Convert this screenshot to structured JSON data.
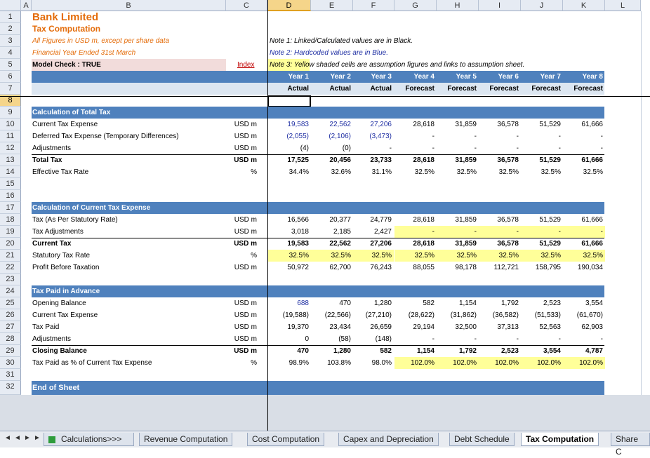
{
  "columns": [
    "A",
    "B",
    "C",
    "D",
    "E",
    "F",
    "G",
    "H",
    "I",
    "J",
    "K",
    "L"
  ],
  "rows": [
    "1",
    "2",
    "3",
    "4",
    "5",
    "6",
    "7",
    "8",
    "9",
    "10",
    "11",
    "12",
    "13",
    "14",
    "15",
    "16",
    "17",
    "18",
    "19",
    "20",
    "21",
    "22",
    "23",
    "24",
    "25",
    "26",
    "27",
    "28",
    "29",
    "30",
    "31",
    "32"
  ],
  "header": {
    "title": "Bank Limited",
    "subtitle": "Tax Computation",
    "figures_note": "All Figures in USD m, except per share data",
    "fy_note": "Financial Year Ended 31st March",
    "model_check": "Model Check : TRUE",
    "index_link": "Index",
    "note1": "Note 1: Linked/Calculated values are in Black.",
    "note2": "Note 2: Hardcoded values are in Blue.",
    "note3": "Note 3: Yellow shaded cells are assumption figures and links to assumption sheet."
  },
  "years": [
    "Year 1",
    "Year 2",
    "Year 3",
    "Year 4",
    "Year 5",
    "Year 6",
    "Year 7",
    "Year 8"
  ],
  "periods": [
    "Actual",
    "Actual",
    "Actual",
    "Forecast",
    "Forecast",
    "Forecast",
    "Forecast",
    "Forecast"
  ],
  "sections": {
    "total_tax": "Calculation of Total Tax",
    "current_tax": "Calculation of Current Tax Expense",
    "advance": "Tax Paid in Advance",
    "end": "End of Sheet"
  },
  "rows_data": {
    "r10": {
      "label": "Current Tax Expense",
      "unit": "USD m",
      "vals": [
        "19,583",
        "22,562",
        "27,206",
        "28,618",
        "31,859",
        "36,578",
        "51,529",
        "61,666"
      ]
    },
    "r11": {
      "label": "Deferred Tax Expense (Temporary Differences)",
      "unit": "USD m",
      "vals": [
        "(2,055)",
        "(2,106)",
        "(3,473)",
        "-",
        "-",
        "-",
        "-",
        "-"
      ]
    },
    "r12": {
      "label": "Adjustments",
      "unit": "USD m",
      "vals": [
        "(4)",
        "(0)",
        "-",
        "-",
        "-",
        "-",
        "-",
        "-"
      ]
    },
    "r13": {
      "label": "Total Tax",
      "unit": "USD m",
      "vals": [
        "17,525",
        "20,456",
        "23,733",
        "28,618",
        "31,859",
        "36,578",
        "51,529",
        "61,666"
      ]
    },
    "r14": {
      "label": "Effective Tax Rate",
      "unit": "%",
      "vals": [
        "34.4%",
        "32.6%",
        "31.1%",
        "32.5%",
        "32.5%",
        "32.5%",
        "32.5%",
        "32.5%"
      ]
    },
    "r18": {
      "label": "Tax (As Per Statutory Rate)",
      "unit": "USD m",
      "vals": [
        "16,566",
        "20,377",
        "24,779",
        "28,618",
        "31,859",
        "36,578",
        "51,529",
        "61,666"
      ]
    },
    "r19": {
      "label": "Tax Adjustments",
      "unit": "USD m",
      "vals": [
        "3,018",
        "2,185",
        "2,427",
        "-",
        "-",
        "-",
        "-",
        "-"
      ]
    },
    "r20": {
      "label": "Current Tax",
      "unit": "USD m",
      "vals": [
        "19,583",
        "22,562",
        "27,206",
        "28,618",
        "31,859",
        "36,578",
        "51,529",
        "61,666"
      ]
    },
    "r21": {
      "label": "Statutory Tax Rate",
      "unit": "%",
      "vals": [
        "32.5%",
        "32.5%",
        "32.5%",
        "32.5%",
        "32.5%",
        "32.5%",
        "32.5%",
        "32.5%"
      ]
    },
    "r22": {
      "label": "Profit Before Taxation",
      "unit": "USD m",
      "vals": [
        "50,972",
        "62,700",
        "76,243",
        "88,055",
        "98,178",
        "112,721",
        "158,795",
        "190,034"
      ]
    },
    "r25": {
      "label": "Opening Balance",
      "unit": "USD m",
      "vals": [
        "688",
        "470",
        "1,280",
        "582",
        "1,154",
        "1,792",
        "2,523",
        "3,554"
      ]
    },
    "r26": {
      "label": "Current Tax Expense",
      "unit": "USD m",
      "vals": [
        "(19,588)",
        "(22,566)",
        "(27,210)",
        "(28,622)",
        "(31,862)",
        "(36,582)",
        "(51,533)",
        "(61,670)"
      ]
    },
    "r27": {
      "label": "Tax Paid",
      "unit": "USD m",
      "vals": [
        "19,370",
        "23,434",
        "26,659",
        "29,194",
        "32,500",
        "37,313",
        "52,563",
        "62,903"
      ]
    },
    "r28": {
      "label": "Adjustments",
      "unit": "USD m",
      "vals": [
        "0",
        "(58)",
        "(148)",
        "-",
        "-",
        "-",
        "-",
        "-"
      ]
    },
    "r29": {
      "label": "Closing Balance",
      "unit": "USD m",
      "vals": [
        "470",
        "1,280",
        "582",
        "1,154",
        "1,792",
        "2,523",
        "3,554",
        "4,787"
      ]
    },
    "r30": {
      "label": "Tax Paid as % of Current Tax Expense",
      "unit": "%",
      "vals": [
        "98.9%",
        "103.8%",
        "98.0%",
        "102.0%",
        "102.0%",
        "102.0%",
        "102.0%",
        "102.0%"
      ]
    }
  },
  "tabs": [
    "Calculations>>>",
    "Revenue Computation",
    "Cost Computation",
    "Capex and Depreciation",
    "Debt Schedule",
    "Tax Computation",
    "Share C"
  ],
  "colors": {
    "accent": "#4f81bd",
    "title": "#e46c0a",
    "hardcoded": "#1f2fa3",
    "assumption": "#ffff99"
  }
}
